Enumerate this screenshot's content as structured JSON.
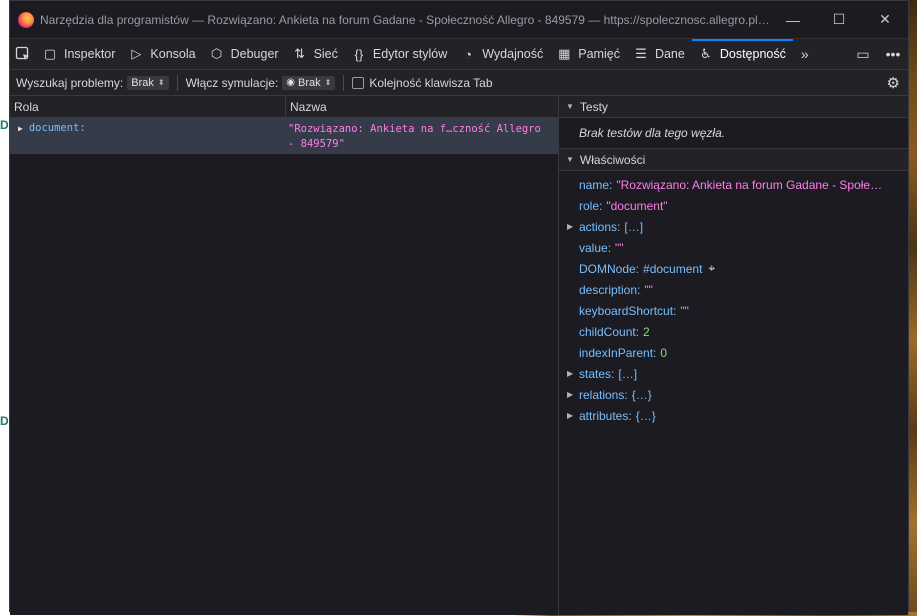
{
  "window": {
    "title": "Narzędzia dla programistów — Rozwiązano: Ankieta na forum Gadane - Społeczność Allegro - 849579 — https://spolecznosc.allegro.pl/t5...",
    "minimize": "—",
    "maximize": "☐",
    "close": "✕"
  },
  "toolbar": {
    "picker_icon": "element-picker-icon",
    "tabs": [
      {
        "label": "Inspektor",
        "icon": "inspector-icon",
        "glyph": "▢"
      },
      {
        "label": "Konsola",
        "icon": "console-icon",
        "glyph": "▷"
      },
      {
        "label": "Debuger",
        "icon": "debugger-icon",
        "glyph": "⬡"
      },
      {
        "label": "Sieć",
        "icon": "network-icon",
        "glyph": "⇅"
      },
      {
        "label": "Edytor stylów",
        "icon": "style-editor-icon",
        "glyph": "{}"
      },
      {
        "label": "Wydajność",
        "icon": "performance-icon",
        "glyph": "◔"
      },
      {
        "label": "Pamięć",
        "icon": "memory-icon",
        "glyph": "▦"
      },
      {
        "label": "Dane",
        "icon": "storage-icon",
        "glyph": "☰"
      },
      {
        "label": "Dostępność",
        "icon": "accessibility-icon",
        "glyph": "♿"
      }
    ],
    "more": "»",
    "dock": "▭",
    "menu": "•••"
  },
  "filterbar": {
    "search_label": "Wyszukaj problemy:",
    "search_value": "Brak",
    "simulate_label": "Włącz symulacje:",
    "simulate_value": "Brak",
    "tab_order_label": "Kolejność klawisza Tab",
    "settings": "⚙"
  },
  "tree": {
    "col_role": "Rola",
    "col_name": "Nazwa",
    "rows": [
      {
        "role": "document:",
        "name": "\"Rozwiązano: Ankieta na f…czność Allegro - 849579\""
      }
    ]
  },
  "sidebar": {
    "tests_header": "Testy",
    "tests_empty": "Brak testów dla tego węzła.",
    "props_header": "Właściwości",
    "props": [
      {
        "key": "name:",
        "value": "\"Rozwiązano: Ankieta na forum Gadane - Społecz…",
        "kind": "str",
        "expandable": false
      },
      {
        "key": "role:",
        "value": "\"document\"",
        "kind": "str",
        "expandable": false
      },
      {
        "key": "actions:",
        "value": "[…]",
        "kind": "obj",
        "expandable": true
      },
      {
        "key": "value:",
        "value": "\"\"",
        "kind": "str",
        "expandable": false
      },
      {
        "key": "DOMNode:",
        "value": "#document",
        "kind": "node",
        "expandable": false
      },
      {
        "key": "description:",
        "value": "\"\"",
        "kind": "str",
        "expandable": false
      },
      {
        "key": "keyboardShortcut:",
        "value": "\"\"",
        "kind": "str",
        "expandable": false
      },
      {
        "key": "childCount:",
        "value": "2",
        "kind": "num",
        "expandable": false
      },
      {
        "key": "indexInParent:",
        "value": "0",
        "kind": "num",
        "expandable": false
      },
      {
        "key": "states:",
        "value": "[…]",
        "kind": "obj",
        "expandable": true
      },
      {
        "key": "relations:",
        "value": "{…}",
        "kind": "obj",
        "expandable": true
      },
      {
        "key": "attributes:",
        "value": "{…}",
        "kind": "obj",
        "expandable": true
      }
    ]
  },
  "colors": {
    "accent": "#0a84ff",
    "string": "#ff7de9",
    "key": "#75bfff",
    "number": "#86de74",
    "background": "#1c1b22"
  }
}
